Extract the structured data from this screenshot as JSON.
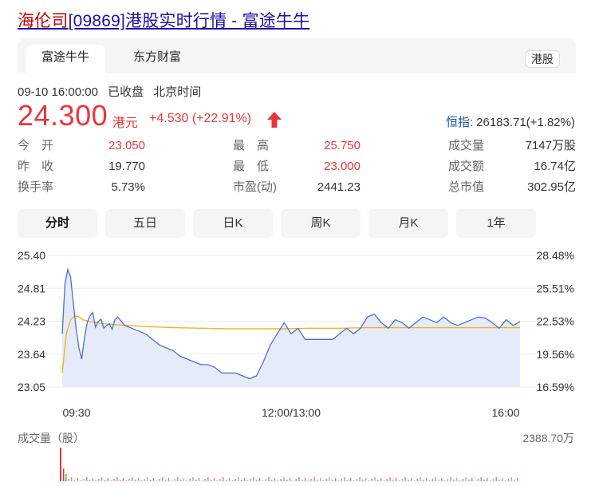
{
  "header": {
    "title_prefix": "海伦司",
    "title_rest": "[09869]港股实时行情 - 富途牛牛"
  },
  "source_tabs": {
    "active": "富途牛牛",
    "second": "东方财富",
    "market_badge": "港股"
  },
  "quote": {
    "datetime": "09-10 16:00:00",
    "status": "已收盘",
    "timezone": "北京时间",
    "price": "24.300",
    "currency": "港元",
    "change": "+4.530 (+22.91%)",
    "index_name": "恒指:",
    "index_value": "26183.71(+1.82%)"
  },
  "stats": [
    {
      "label": "今　开",
      "value": "23.050",
      "color": "red"
    },
    {
      "label": "最　高",
      "value": "25.750",
      "color": "red"
    },
    {
      "label": "成交量",
      "value": "7147万股",
      "color": "normal"
    },
    {
      "label": "昨　收",
      "value": "19.770",
      "color": "normal"
    },
    {
      "label": "最　低",
      "value": "23.000",
      "color": "red"
    },
    {
      "label": "成交额",
      "value": "16.74亿",
      "color": "normal"
    },
    {
      "label": "换手率",
      "value": "5.73%",
      "color": "normal"
    },
    {
      "label": "市盈(动)",
      "value": "2441.23",
      "color": "normal"
    },
    {
      "label": "总市值",
      "value": "302.95亿",
      "color": "normal"
    }
  ],
  "period_tabs": [
    "分时",
    "五日",
    "日K",
    "周K",
    "月K",
    "1年"
  ],
  "active_period": "分时",
  "colors": {
    "up_red": "#e8363c",
    "price_line": "#4a6fd4",
    "avg_line": "#f2b51c",
    "area_fill": "#e6ebfa",
    "link_blue": "#1a0dab"
  },
  "chart_data": {
    "type": "line",
    "y_ticks_left": [
      "25.40",
      "24.81",
      "24.23",
      "23.64",
      "23.05"
    ],
    "y_ticks_right": [
      "28.48%",
      "25.51%",
      "22.53%",
      "19.56%",
      "16.59%"
    ],
    "x_ticks": [
      "09:30",
      "12:00/13:00",
      "16:00"
    ],
    "ylim": [
      23.05,
      25.4
    ],
    "xlim": [
      0,
      330
    ],
    "series": [
      {
        "key": "price",
        "x": [
          0,
          2,
          4,
          6,
          8,
          10,
          12,
          14,
          16,
          18,
          20,
          22,
          24,
          26,
          28,
          30,
          32,
          34,
          36,
          38,
          40,
          45,
          50,
          55,
          60,
          65,
          70,
          75,
          80,
          85,
          90,
          95,
          100,
          105,
          110,
          115,
          120,
          125,
          130,
          135,
          140,
          145,
          150,
          155,
          160,
          165,
          170,
          175,
          180,
          185,
          190,
          195,
          200,
          205,
          210,
          215,
          220,
          225,
          230,
          235,
          240,
          245,
          250,
          255,
          260,
          265,
          270,
          275,
          280,
          285,
          290,
          295,
          300,
          305,
          310,
          315,
          320,
          325,
          330
        ],
        "y": [
          24.0,
          24.9,
          25.15,
          25.02,
          24.55,
          24.1,
          23.75,
          23.55,
          23.92,
          24.2,
          24.32,
          24.38,
          24.12,
          24.22,
          24.26,
          24.1,
          24.15,
          24.18,
          24.08,
          24.25,
          24.3,
          24.15,
          24.1,
          24.05,
          24.0,
          23.9,
          23.8,
          23.75,
          23.7,
          23.6,
          23.55,
          23.5,
          23.45,
          23.45,
          23.4,
          23.3,
          23.3,
          23.3,
          23.25,
          23.2,
          23.25,
          23.5,
          23.8,
          24.0,
          24.2,
          24.0,
          24.1,
          23.9,
          23.9,
          23.9,
          23.9,
          23.9,
          24.0,
          24.1,
          24.0,
          24.1,
          24.3,
          24.35,
          24.2,
          24.1,
          24.25,
          24.2,
          24.1,
          24.2,
          24.3,
          24.25,
          24.2,
          24.3,
          24.2,
          24.15,
          24.2,
          24.25,
          24.3,
          24.28,
          24.2,
          24.1,
          24.25,
          24.15,
          24.22
        ]
      },
      {
        "key": "average",
        "x": [
          0,
          3,
          6,
          9,
          12,
          15,
          20,
          30,
          40,
          60,
          80,
          100,
          120,
          140,
          160,
          180,
          200,
          220,
          240,
          260,
          280,
          300,
          320,
          330
        ],
        "y": [
          23.3,
          24.0,
          24.25,
          24.32,
          24.3,
          24.25,
          24.22,
          24.18,
          24.16,
          24.13,
          24.11,
          24.1,
          24.09,
          24.09,
          24.09,
          24.1,
          24.1,
          24.11,
          24.11,
          24.11,
          24.11,
          24.11,
          24.11,
          24.11
        ]
      }
    ],
    "volume": {
      "label": "成交量（股）",
      "max_label": "2388.70万"
    }
  }
}
